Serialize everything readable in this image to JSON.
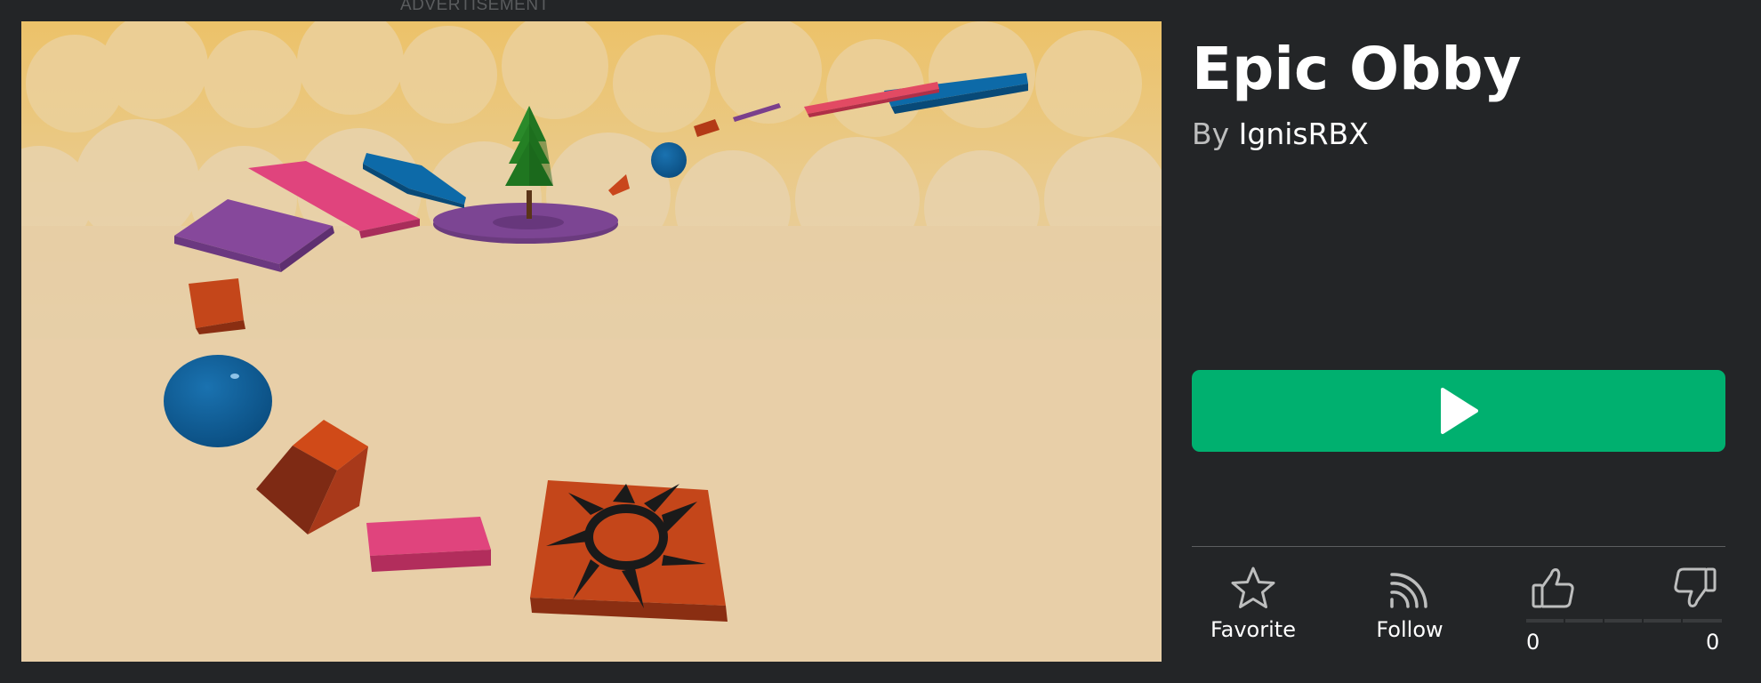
{
  "ad_label": "ADVERTISEMENT",
  "game": {
    "title": "Epic Obby",
    "by_prefix": "By",
    "creator": "IgnisRBX"
  },
  "play_button": {
    "icon": "play-icon",
    "color": "#00b06f"
  },
  "actions": {
    "favorite_label": "Favorite",
    "follow_label": "Follow"
  },
  "votes": {
    "up_count": "0",
    "down_count": "0"
  },
  "colors": {
    "background": "#232527",
    "divider": "#5c5e60"
  }
}
